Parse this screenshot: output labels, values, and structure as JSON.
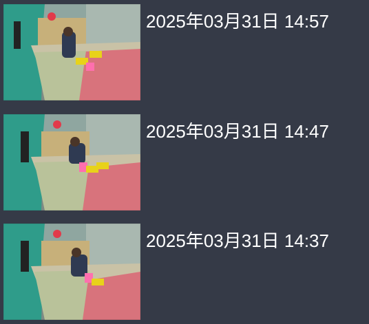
{
  "recordings": [
    {
      "timestamp": "2025年03月31日 14:57",
      "thumbnail_icon": "video-thumbnail"
    },
    {
      "timestamp": "2025年03月31日 14:47",
      "thumbnail_icon": "video-thumbnail"
    },
    {
      "timestamp": "2025年03月31日 14:37",
      "thumbnail_icon": "video-thumbnail"
    }
  ],
  "colors": {
    "background": "#353a47",
    "text": "#ffffff"
  }
}
